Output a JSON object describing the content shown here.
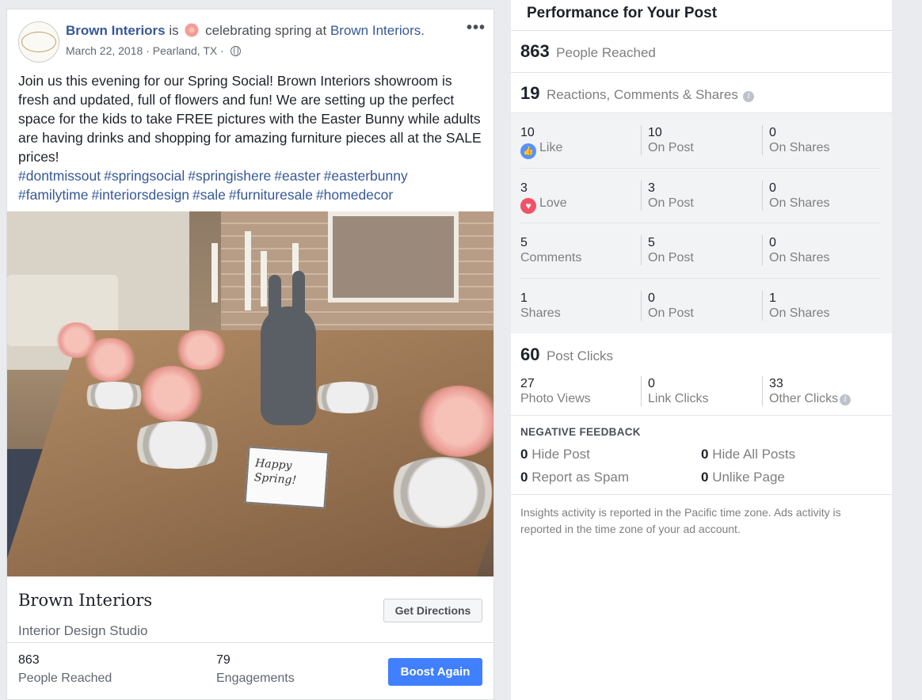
{
  "post": {
    "page_name": "Brown Interiors",
    "is_text": "is",
    "feeling": "celebrating spring at",
    "location_page": "Brown Interiors.",
    "date": "March 22, 2018",
    "separator": "·",
    "place": "Pearland, TX",
    "more_label": "•••",
    "body": "Join us this evening for our Spring Social! Brown Interiors showroom is fresh and updated, full of flowers and fun! We are setting up the perfect space for the kids to take FREE pictures with the Easter Bunny while adults are having drinks and shopping for amazing furniture pieces all at the SALE prices!",
    "hashtags": [
      "#dontmissout",
      "#springsocial",
      "#springishere",
      "#easter",
      "#easterbunny",
      "#familytime",
      "#interiorsdesign",
      "#sale",
      "#furnituresale",
      "#homedecor"
    ],
    "photo_sign": "Happy Spring!",
    "card_name": "Brown Interiors",
    "card_category": "Interior Design Studio",
    "directions_label": "Get Directions",
    "stats": {
      "reached_value": "863",
      "reached_label": "People Reached",
      "engagements_value": "79",
      "engagements_label": "Engagements"
    },
    "boost_label": "Boost Again"
  },
  "insights": {
    "title": "Performance for Your Post",
    "reached": {
      "value": "863",
      "label": "People Reached"
    },
    "reactions": {
      "value": "19",
      "label": "Reactions, Comments & Shares",
      "info": "i"
    },
    "rows": [
      {
        "value": "10",
        "label": "Like",
        "icon": "like-icon",
        "on_post": "10",
        "on_post_label": "On Post",
        "on_shares": "0",
        "on_shares_label": "On Shares"
      },
      {
        "value": "3",
        "label": "Love",
        "icon": "love-icon",
        "on_post": "3",
        "on_post_label": "On Post",
        "on_shares": "0",
        "on_shares_label": "On Shares"
      },
      {
        "value": "5",
        "label": "Comments",
        "on_post": "5",
        "on_post_label": "On Post",
        "on_shares": "0",
        "on_shares_label": "On Shares"
      },
      {
        "value": "1",
        "label": "Shares",
        "on_post": "0",
        "on_post_label": "On Post",
        "on_shares": "1",
        "on_shares_label": "On Shares"
      }
    ],
    "clicks": {
      "value": "60",
      "label": "Post Clicks",
      "photo_views": "27",
      "photo_views_label": "Photo Views",
      "link_clicks": "0",
      "link_clicks_label": "Link Clicks",
      "other_clicks": "33",
      "other_clicks_label": "Other Clicks"
    },
    "negative": {
      "title": "NEGATIVE FEEDBACK",
      "hide_post": "0",
      "hide_post_label": "Hide Post",
      "hide_all": "0",
      "hide_all_label": "Hide All Posts",
      "spam": "0",
      "spam_label": "Report as Spam",
      "unlike": "0",
      "unlike_label": "Unlike Page"
    },
    "footnote": "Insights activity is reported in the Pacific time zone. Ads activity is reported in the time zone of your ad account."
  },
  "colors": {
    "link": "#365899",
    "boost": "#4080ff",
    "like": "#5890ff",
    "love": "#f25268"
  }
}
